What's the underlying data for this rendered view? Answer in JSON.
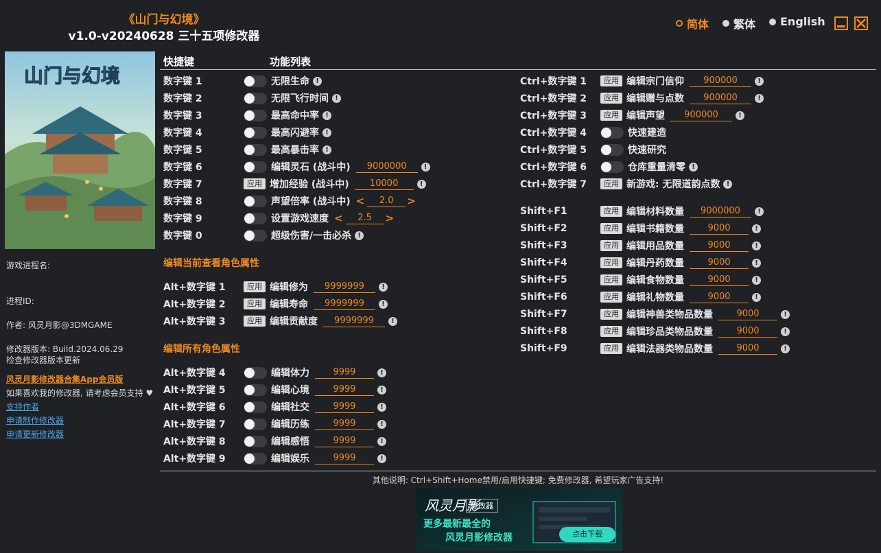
{
  "header": {
    "title_cn": "《山门与幻境》",
    "subtitle": "v1.0-v20240628 三十五项修改器"
  },
  "languages": [
    {
      "label": "简体",
      "active": true
    },
    {
      "label": "繁体",
      "active": false
    },
    {
      "label": "English",
      "active": false
    }
  ],
  "cover": {
    "logo_text": "山门与幻境"
  },
  "sidebar": {
    "process_name_label": "游戏进程名:",
    "process_id_label": "进程ID:",
    "author": "作者: 风灵月影@3DMGAME",
    "version": "修改器版本: Build.2024.06.29",
    "check_update": "检查修改器版本更新",
    "app_link": "风灵月影修改器合集App会员版",
    "support_note": "如果喜欢我的修改器, 请考虑会员支持",
    "support_author": "支持作者",
    "request_make": "申请制作修改器",
    "request_update": "申请更新修改器"
  },
  "columns": {
    "hotkey": "快捷键",
    "features": "功能列表"
  },
  "left_rows": [
    {
      "key": "数字键 1",
      "control": "toggle",
      "label": "无限生命",
      "warn": true
    },
    {
      "key": "数字键 2",
      "control": "toggle",
      "label": "无限飞行时间",
      "warn": true
    },
    {
      "key": "数字键 3",
      "control": "toggle",
      "label": "最高命中率",
      "warn": true
    },
    {
      "key": "数字键 4",
      "control": "toggle",
      "label": "最高闪避率",
      "warn": true
    },
    {
      "key": "数字键 5",
      "control": "toggle",
      "label": "最高暴击率",
      "warn": true
    },
    {
      "key": "数字键 6",
      "control": "toggle",
      "label": "编辑灵石 (战斗中)",
      "value": "9000000",
      "warn": true
    },
    {
      "key": "数字键 7",
      "control": "apply",
      "label": "增加经验 (战斗中)",
      "value": "10000",
      "warn": true
    },
    {
      "key": "数字键 8",
      "control": "toggle",
      "label": "声望倍率 (战斗中)",
      "stepper": "2.0"
    },
    {
      "key": "数字键 9",
      "control": "toggle",
      "label": "设置游戏速度",
      "stepper": "2.5"
    },
    {
      "key": "数字键 0",
      "control": "toggle",
      "label": "超级伤害/一击必杀",
      "warn": true
    }
  ],
  "section_current": "编辑当前查看角色属性",
  "current_rows": [
    {
      "key": "Alt+数字键 1",
      "control": "apply",
      "label": "编辑修为",
      "value": "9999999",
      "warn": true
    },
    {
      "key": "Alt+数字键 2",
      "control": "apply",
      "label": "编辑寿命",
      "value": "9999999",
      "warn": true
    },
    {
      "key": "Alt+数字键 3",
      "control": "apply",
      "label": "编辑贡献度",
      "value": "9999999",
      "warn": true
    }
  ],
  "section_all": "编辑所有角色属性",
  "all_rows": [
    {
      "key": "Alt+数字键 4",
      "control": "toggle",
      "label": "编辑体力",
      "value": "9999",
      "warn": true
    },
    {
      "key": "Alt+数字键 5",
      "control": "toggle",
      "label": "编辑心境",
      "value": "9999",
      "warn": true
    },
    {
      "key": "Alt+数字键 6",
      "control": "toggle",
      "label": "编辑社交",
      "value": "9999",
      "warn": true
    },
    {
      "key": "Alt+数字键 7",
      "control": "toggle",
      "label": "编辑历练",
      "value": "9999",
      "warn": true
    },
    {
      "key": "Alt+数字键 8",
      "control": "toggle",
      "label": "编辑感悟",
      "value": "9999",
      "warn": true
    },
    {
      "key": "Alt+数字键 9",
      "control": "toggle",
      "label": "编辑娱乐",
      "value": "9999",
      "warn": true
    }
  ],
  "ctrl_rows": [
    {
      "key": "Ctrl+数字键 1",
      "control": "apply",
      "label": "编辑宗门信仰",
      "value": "900000",
      "warn": true
    },
    {
      "key": "Ctrl+数字键 2",
      "control": "apply",
      "label": "编辑赠与点数",
      "value": "900000",
      "warn": true
    },
    {
      "key": "Ctrl+数字键 3",
      "control": "apply",
      "label": "编辑声望",
      "value": "900000",
      "warn": true
    },
    {
      "key": "Ctrl+数字键 4",
      "control": "toggle",
      "label": "快速建造"
    },
    {
      "key": "Ctrl+数字键 5",
      "control": "toggle",
      "label": "快速研究"
    },
    {
      "key": "Ctrl+数字键 6",
      "control": "toggle",
      "label": "仓库重量清零",
      "warn": true
    },
    {
      "key": "Ctrl+数字键 7",
      "control": "apply",
      "label": "新游戏: 无限道韵点数",
      "warn": true
    }
  ],
  "shift_rows": [
    {
      "key": "Shift+F1",
      "control": "apply",
      "label": "编辑材料数量",
      "value": "9000000",
      "warn": true
    },
    {
      "key": "Shift+F2",
      "control": "apply",
      "label": "编辑书籍数量",
      "value": "9000",
      "warn": true
    },
    {
      "key": "Shift+F3",
      "control": "apply",
      "label": "编辑用品数量",
      "value": "9000",
      "warn": true
    },
    {
      "key": "Shift+F4",
      "control": "apply",
      "label": "编辑丹药数量",
      "value": "9000",
      "warn": true
    },
    {
      "key": "Shift+F5",
      "control": "apply",
      "label": "编辑食物数量",
      "value": "9000",
      "warn": true
    },
    {
      "key": "Shift+F6",
      "control": "apply",
      "label": "编辑礼物数量",
      "value": "9000",
      "warn": true
    },
    {
      "key": "Shift+F7",
      "control": "apply",
      "label": "编辑神兽类物品数量",
      "value": "9000",
      "warn": true
    },
    {
      "key": "Shift+F8",
      "control": "apply",
      "label": "编辑珍品类物品数量",
      "value": "9000",
      "warn": true
    },
    {
      "key": "Shift+F9",
      "control": "apply",
      "label": "编辑法器类物品数量",
      "value": "9000",
      "warn": true
    }
  ],
  "apply_label": "应用",
  "footer_note": "其他说明: Ctrl+Shift+Home禁用/启用快捷键; 免费修改器, 希望玩家广告支持!",
  "banner": {
    "brand": "风灵月影",
    "tag": "修改器",
    "line1": "更多最新最全的",
    "line2": "风灵月影修改器",
    "cta": "点击下载"
  },
  "colors": {
    "accent": "#f08a1e",
    "background": "#1f2124",
    "link": "#4aa3e8"
  },
  "icons": {
    "warn": "exclamation-circle-icon",
    "minimize": "minimize-icon",
    "close": "close-icon"
  }
}
